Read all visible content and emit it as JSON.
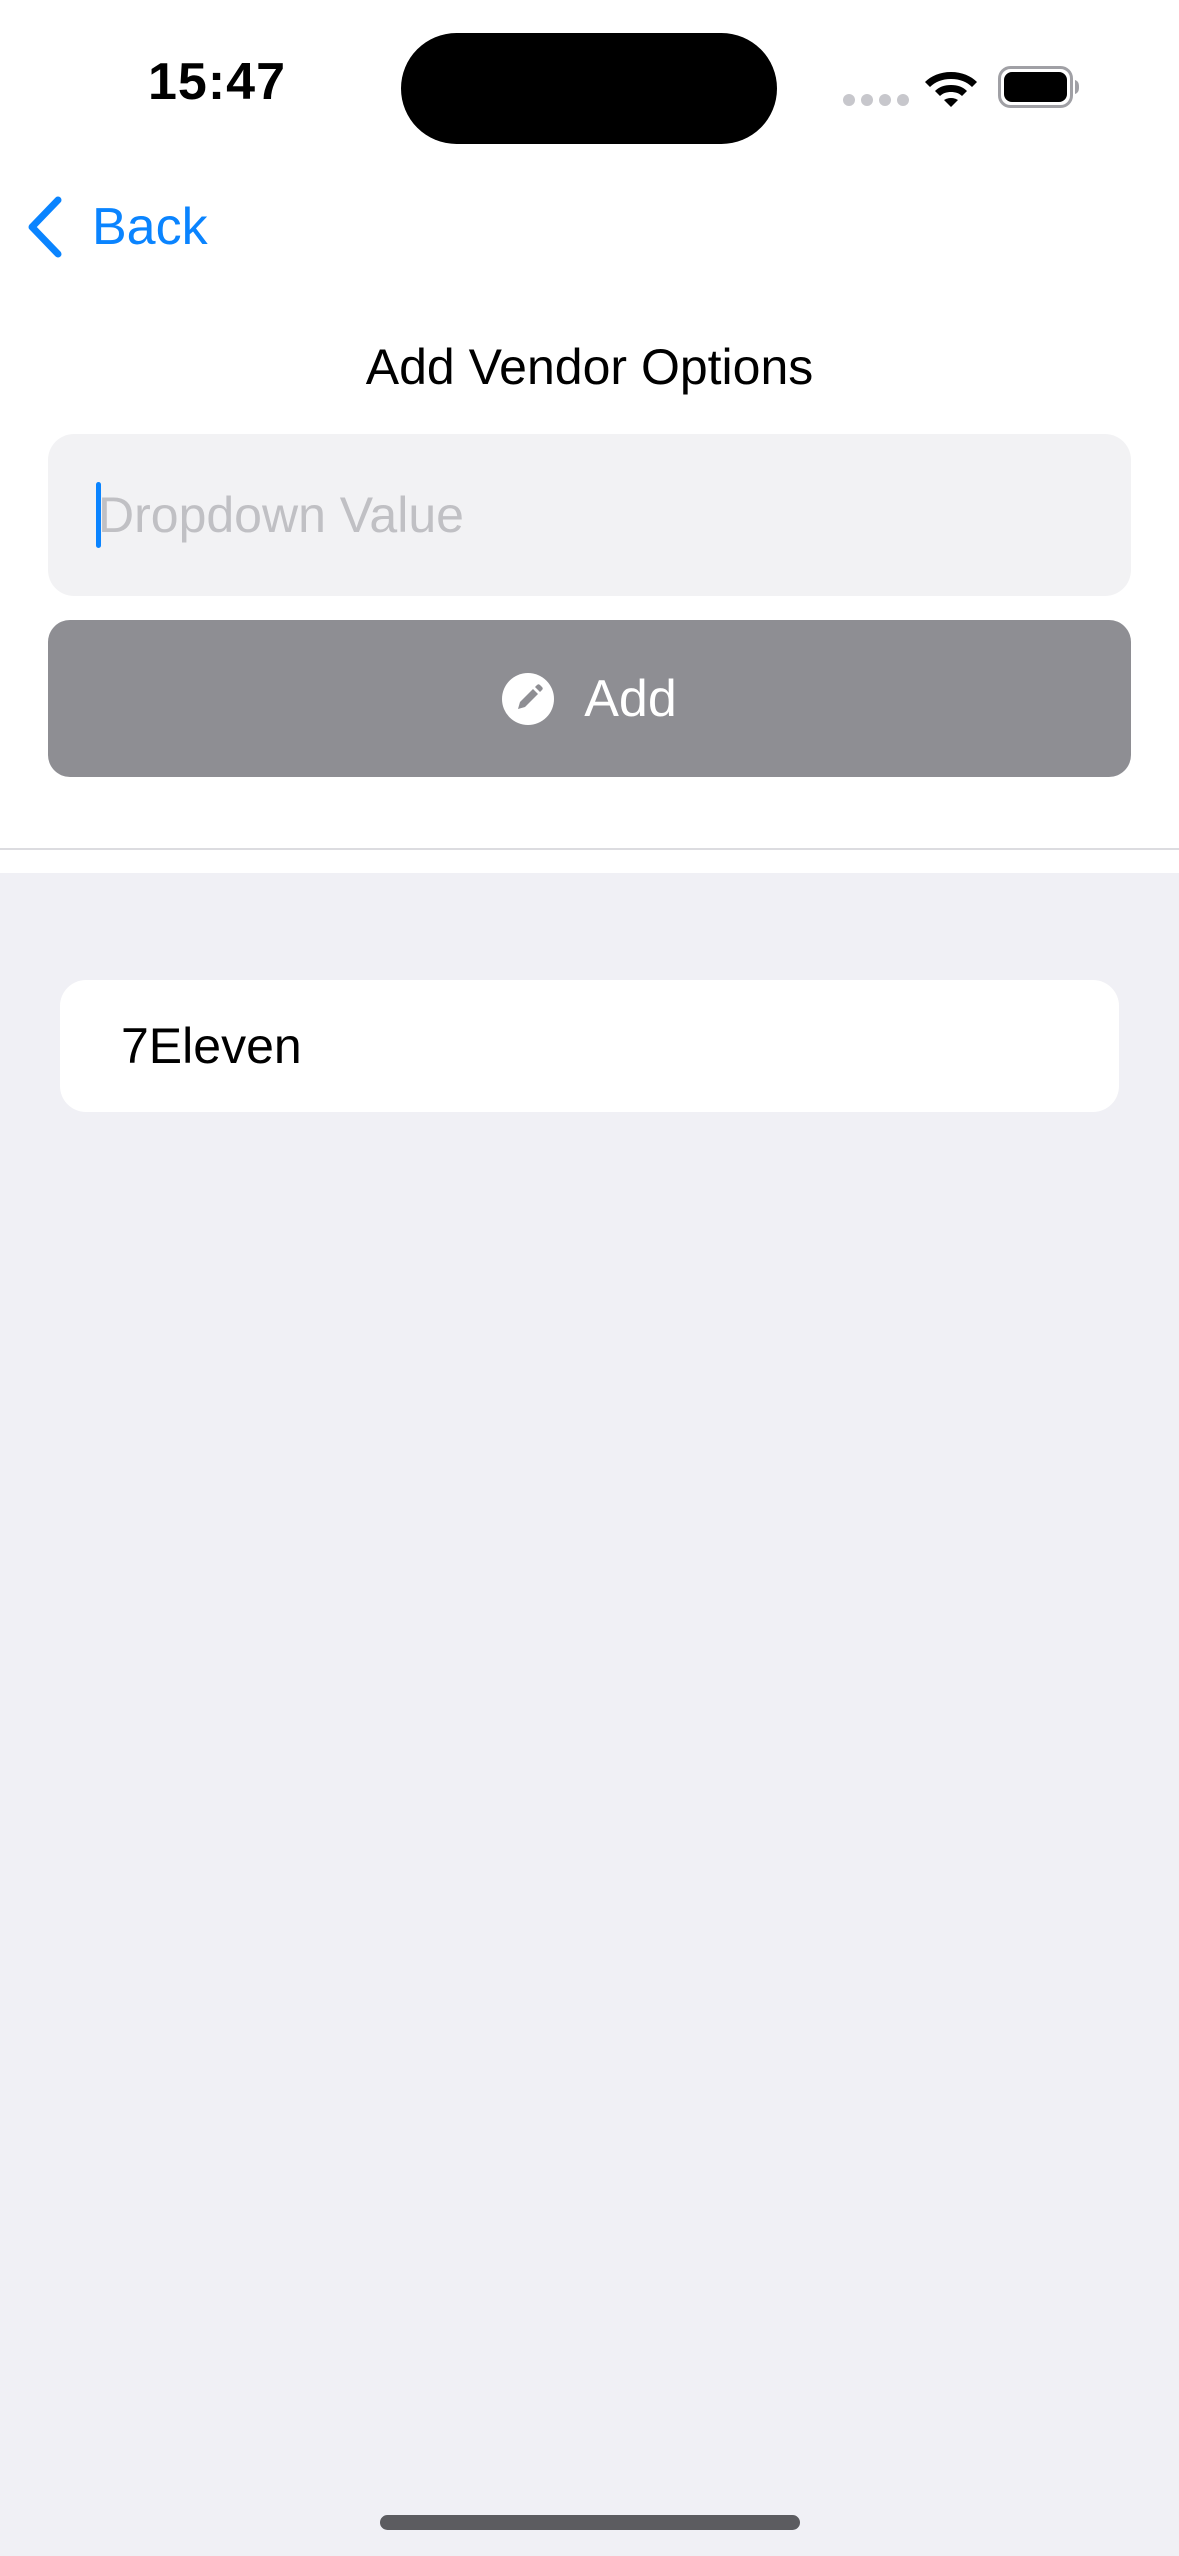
{
  "status_bar": {
    "time": "15:47",
    "icons": [
      "cellular-signal-icon",
      "wifi-icon",
      "battery-icon"
    ]
  },
  "nav": {
    "back_label": "Back",
    "back_icon": "chevron-left-icon"
  },
  "page": {
    "title": "Add Vendor Options"
  },
  "form": {
    "input_value": "",
    "input_placeholder": "Dropdown Value",
    "add_label": "Add",
    "add_icon": "pencil-circle-icon"
  },
  "vendors": {
    "items": [
      {
        "label": "7Eleven"
      }
    ]
  },
  "colors": {
    "accent": "#0a84ff",
    "button_disabled": "#8e8e93",
    "input_bg": "#f2f2f4",
    "list_bg": "#f0f0f5"
  }
}
